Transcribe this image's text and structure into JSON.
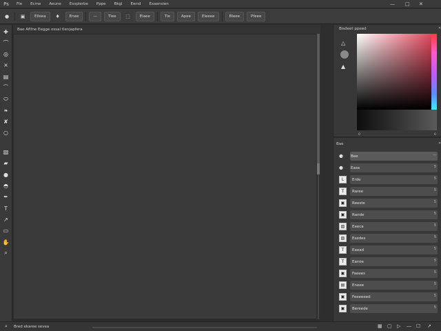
{
  "menubar": {
    "logo_glyph": "Ps",
    "items": [
      "Fle",
      "Ecme",
      "Aeune",
      "Exsplerbe",
      "Pppe",
      "Bkgl",
      "Ewnd",
      "Exaensien"
    ],
    "minimize_glyph": "—",
    "restore_glyph": "□",
    "close_glyph": "✕"
  },
  "optionsbar": {
    "tool_glyph": "●",
    "buttons": [
      "▣",
      "Elleea",
      "♦",
      "Enee",
      "—",
      "Tlee",
      "⬚",
      "Elaee",
      "Tle",
      "Apee",
      "Eleeee",
      "Bleee",
      "Pfeee"
    ]
  },
  "toolbar": {
    "tools": [
      "move-tool",
      "lasso-tool",
      "quick-select-tool",
      "crop-tool",
      "frame-tool",
      "eyedropper-tool",
      "healing-tool",
      "brush-tool",
      "stamp-tool",
      "history-brush-tool",
      "eraser-tool",
      "gradient-tool",
      "blur-tool",
      "dodge-tool",
      "pen-tool",
      "type-tool",
      "path-select-tool",
      "shape-tool",
      "hand-tool",
      "zoom-tool"
    ],
    "glyphs": [
      "✚",
      "⌒",
      "◎",
      "⨯",
      "▤",
      "⁀",
      "⬭",
      "❧",
      "✘",
      "○",
      "▧",
      "▰",
      "●",
      "◓",
      "✒",
      "T",
      "↗",
      "▭",
      "✋",
      "⌕"
    ]
  },
  "document": {
    "tab_label": "Bae Aflfne Eegge ossal tlenjapfera"
  },
  "statusbar": {
    "zoom_glyph": "⌕",
    "doc_info": "Bred ekaree sevea",
    "icons": [
      "▦",
      "▢",
      "▷",
      "―",
      "☐",
      "↗"
    ]
  },
  "color_panel": {
    "title": "Bisdeet ppeed",
    "close_glyph": "✕",
    "icons": [
      "△",
      "▲"
    ],
    "ramp_labels": [
      "0",
      "0"
    ]
  },
  "layers_panel": {
    "title": "Bae",
    "close_glyph": "✕",
    "layers": [
      {
        "icon": "⚈",
        "label": "Bee",
        "end": "—",
        "active": true,
        "boxed": false
      },
      {
        "icon": "⚈",
        "label": "Ease",
        "end": "5",
        "active": false,
        "boxed": false
      },
      {
        "icon": "L",
        "label": "Erde",
        "end": "5",
        "active": false,
        "boxed": true
      },
      {
        "icon": "T",
        "label": "Raree",
        "end": "5",
        "active": false,
        "boxed": true
      },
      {
        "icon": "▣",
        "label": "Reeste",
        "end": "5",
        "active": false,
        "boxed": true
      },
      {
        "icon": "▣",
        "label": "Rande",
        "end": "5",
        "active": false,
        "boxed": true
      },
      {
        "icon": "▧",
        "label": "Eaeca",
        "end": "5",
        "active": false,
        "boxed": true
      },
      {
        "icon": "▧",
        "label": "Esedes",
        "end": "5",
        "active": false,
        "boxed": true
      },
      {
        "icon": "T",
        "label": "Eaead",
        "end": "5",
        "active": false,
        "boxed": true
      },
      {
        "icon": "T",
        "label": "Earsie",
        "end": "5",
        "active": false,
        "boxed": true
      },
      {
        "icon": "▣",
        "label": "Faeees",
        "end": "5",
        "active": false,
        "boxed": true
      },
      {
        "icon": "▤",
        "label": "Eneee",
        "end": "5",
        "active": false,
        "boxed": true
      },
      {
        "icon": "▣",
        "label": "Feeeeeed",
        "end": "5",
        "active": false,
        "boxed": true
      },
      {
        "icon": "▣",
        "label": "Bereede",
        "end": "5",
        "active": false,
        "boxed": true
      }
    ]
  },
  "colors": {
    "spectrum_hue": "#e23a52",
    "panel_bg": "#383838",
    "canvas_bg": "#3a3a3a"
  }
}
